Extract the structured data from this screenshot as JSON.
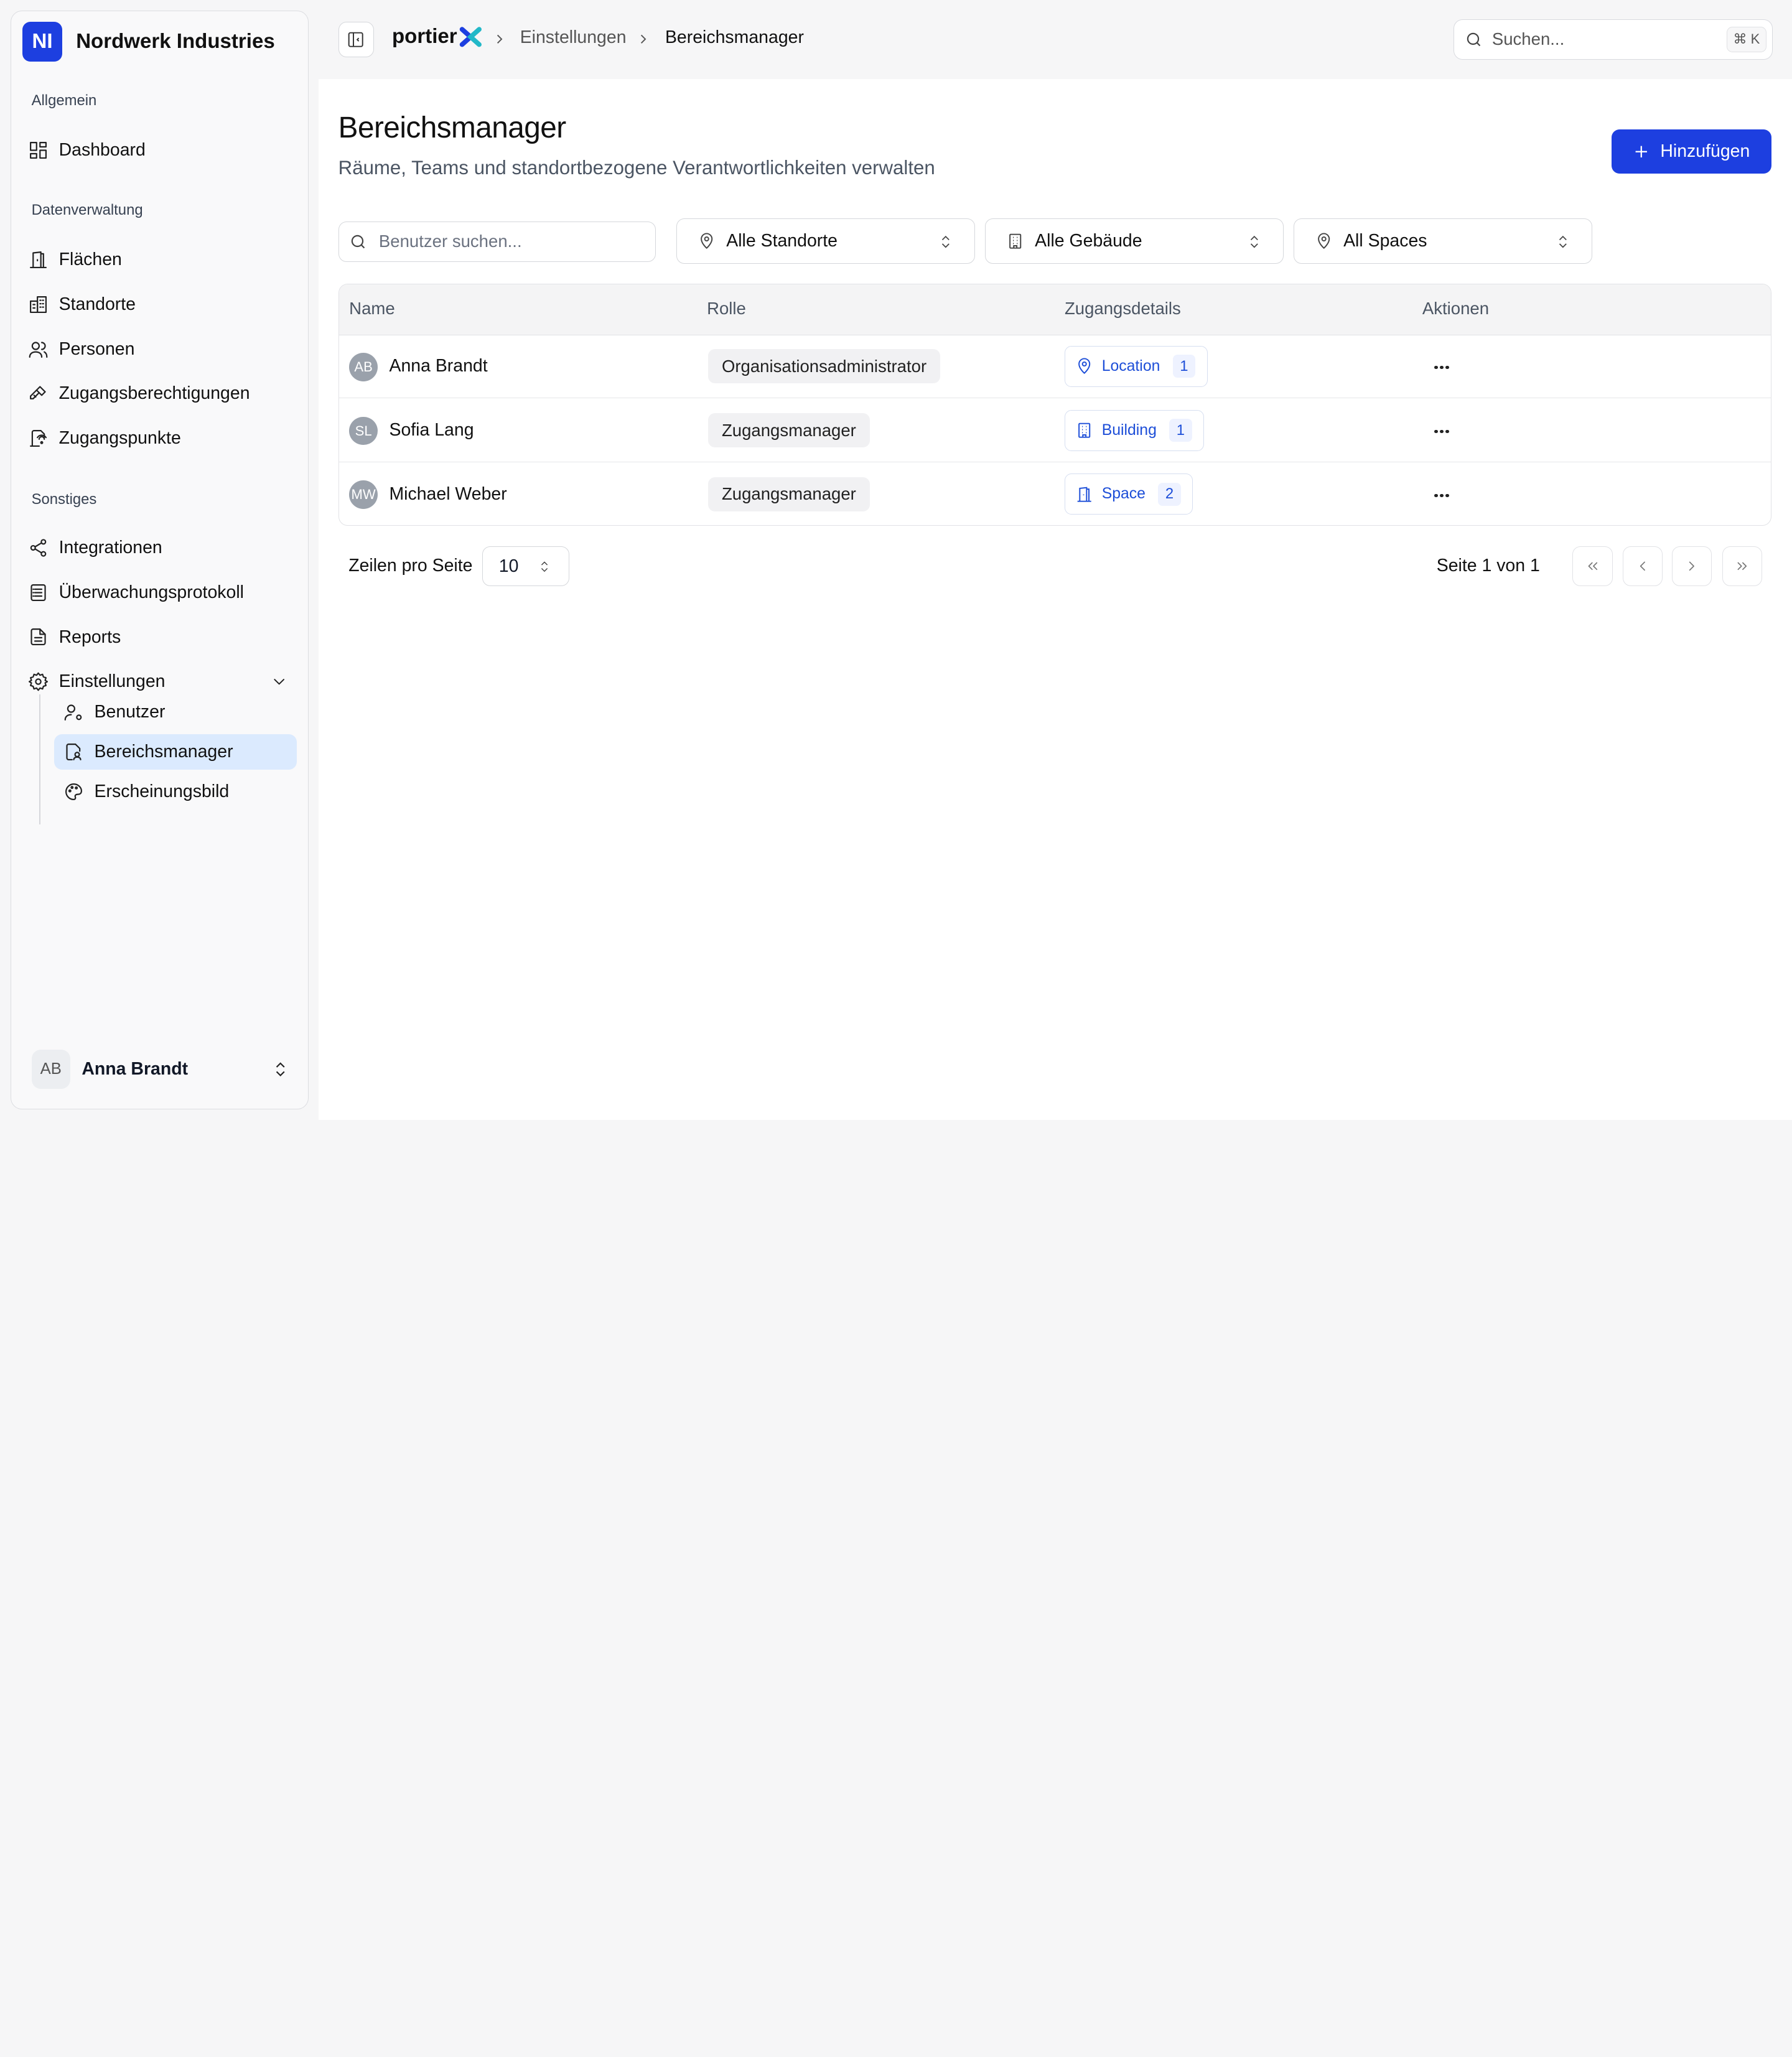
{
  "org": {
    "initials": "NI",
    "name": "Nordwerk Industries",
    "accent": "#1d3fe0"
  },
  "sidebar": {
    "sections": [
      {
        "label": "Allgemein",
        "items": [
          {
            "label": "Dashboard",
            "icon": "dashboard-icon"
          }
        ]
      },
      {
        "label": "Datenverwaltung",
        "items": [
          {
            "label": "Flächen",
            "icon": "door-icon"
          },
          {
            "label": "Standorte",
            "icon": "buildings-icon"
          },
          {
            "label": "Personen",
            "icon": "users-icon"
          },
          {
            "label": "Zugangsberechtigungen",
            "icon": "key-icon"
          },
          {
            "label": "Zugangspunkte",
            "icon": "access-point-icon"
          }
        ]
      },
      {
        "label": "Sonstiges",
        "items": [
          {
            "label": "Integrationen",
            "icon": "share-icon"
          },
          {
            "label": "Überwachungsprotokoll",
            "icon": "log-icon"
          },
          {
            "label": "Reports",
            "icon": "file-icon"
          },
          {
            "label": "Einstellungen",
            "icon": "gear-icon"
          }
        ]
      }
    ],
    "settings_sub": [
      {
        "label": "Benutzer",
        "icon": "user-cog-icon"
      },
      {
        "label": "Bereichsmanager",
        "icon": "area-manager-icon",
        "active": true
      },
      {
        "label": "Erscheinungsbild",
        "icon": "palette-icon"
      }
    ],
    "user": {
      "initials": "AB",
      "name": "Anna Brandt"
    }
  },
  "topbar": {
    "brand": "portier",
    "breadcrumb": [
      "Einstellungen",
      "Bereichsmanager"
    ],
    "search_placeholder": "Suchen...",
    "shortcut": "⌘ K"
  },
  "page": {
    "title": "Bereichsmanager",
    "subtitle": "Räume, Teams und standortbezogene Verantwortlichkeiten verwalten",
    "add_label": "Hinzufügen"
  },
  "filters": {
    "search_placeholder": "Benutzer suchen...",
    "location": "Alle Standorte",
    "building": "Alle Gebäude",
    "space": "All Spaces"
  },
  "table": {
    "headers": [
      "Name",
      "Rolle",
      "Zugangsdetails",
      "Aktionen"
    ],
    "rows": [
      {
        "initials": "AB",
        "name": "Anna Brandt",
        "role": "Organisationsadministrator",
        "access_type": "Location",
        "access_icon": "pin-icon",
        "access_count": "1"
      },
      {
        "initials": "SL",
        "name": "Sofia Lang",
        "role": "Zugangsmanager",
        "access_type": "Building",
        "access_icon": "building-icon",
        "access_count": "1"
      },
      {
        "initials": "MW",
        "name": "Michael Weber",
        "role": "Zugangsmanager",
        "access_type": "Space",
        "access_icon": "door-icon",
        "access_count": "2"
      }
    ]
  },
  "pagination": {
    "rows_label": "Zeilen pro Seite",
    "rows_value": "10",
    "page_info": "Seite 1 von 1"
  }
}
